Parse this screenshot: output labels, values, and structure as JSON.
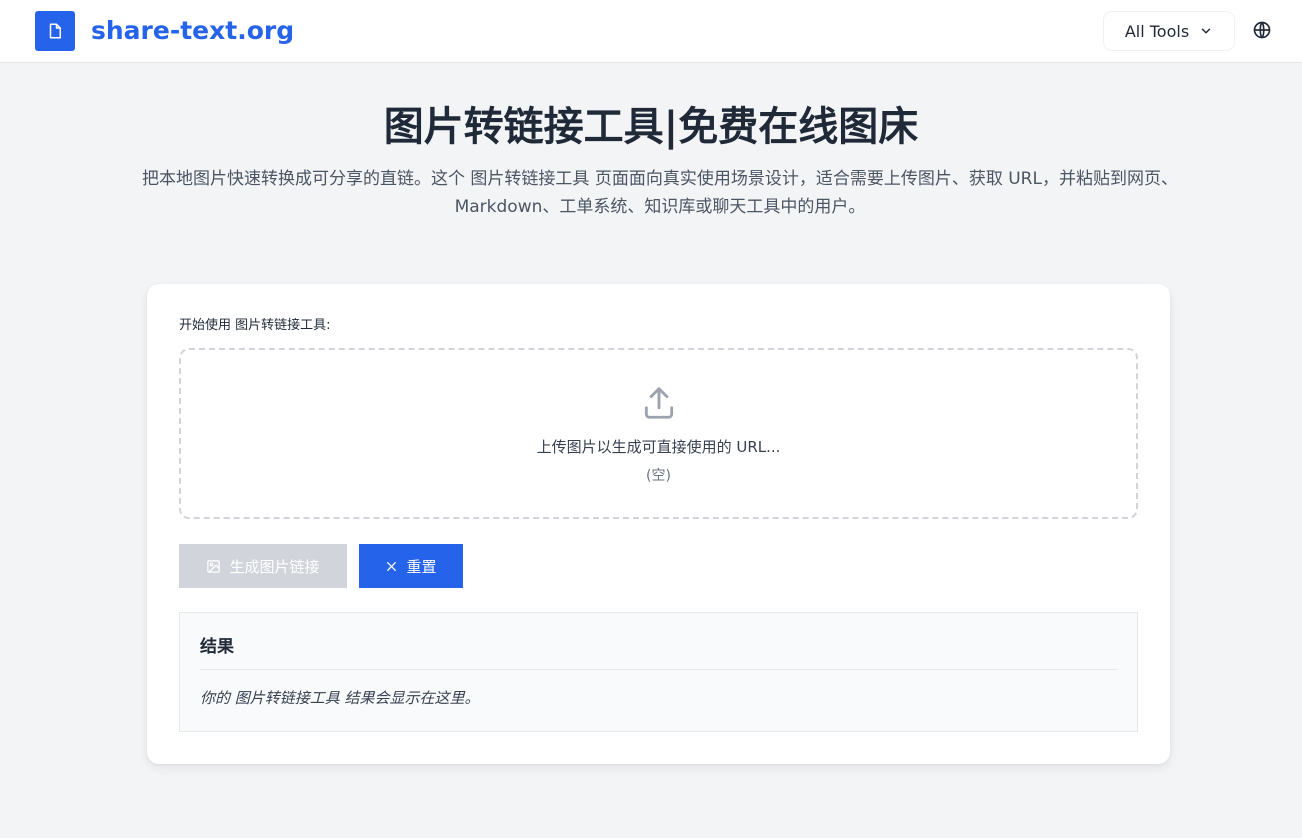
{
  "header": {
    "logo_icon": "document-icon",
    "site_name": "share-text.org",
    "tools_label": "All Tools",
    "tools_icon": "chevron-down-icon",
    "language_icon": "globe-icon",
    "accent_color": "#2563eb"
  },
  "hero": {
    "title": "图片转链接工具|免费在线图床",
    "subtitle": "把本地图片快速转换成可分享的直链。这个 图片转链接工具 页面面向真实使用场景设计，适合需要上传图片、获取 URL，并粘贴到网页、Markdown、工单系统、知识库或聊天工具中的用户。"
  },
  "tool": {
    "label": "开始使用 图片转链接工具:",
    "dropzone": {
      "icon": "upload-icon",
      "text": "上传图片以生成可直接使用的 URL...",
      "empty": "(空)"
    },
    "generate_button": {
      "icon": "image-icon",
      "label": "生成图片链接",
      "disabled": true
    },
    "reset_button": {
      "icon": "close-icon",
      "label": "重置"
    },
    "result": {
      "title": "结果",
      "placeholder": "你的 图片转链接工具 结果会显示在这里。"
    }
  }
}
